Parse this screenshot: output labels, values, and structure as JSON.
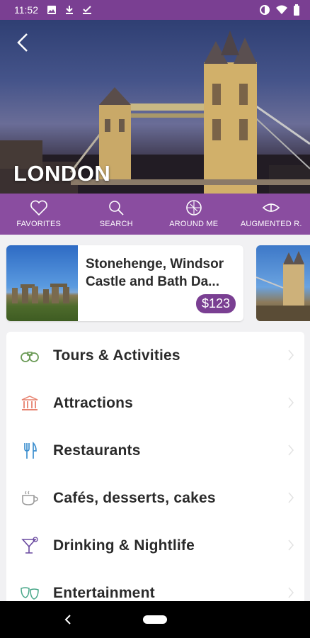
{
  "status_bar": {
    "time": "11:52"
  },
  "hero": {
    "city": "LONDON"
  },
  "tabs": [
    {
      "label": "FAVORITES",
      "icon": "heart-icon"
    },
    {
      "label": "SEARCH",
      "icon": "search-icon"
    },
    {
      "label": "AROUND ME",
      "icon": "compass-icon"
    },
    {
      "label": "AUGMENTED R.",
      "icon": "eye-icon"
    }
  ],
  "featured": {
    "title": "Stonehenge, Windsor Castle and Bath Da...",
    "price": "$123"
  },
  "menu": [
    {
      "label": "Tours & Activities",
      "icon": "binoculars-icon",
      "color": "#6a9a55"
    },
    {
      "label": "Attractions",
      "icon": "museum-icon",
      "color": "#e7826f"
    },
    {
      "label": "Restaurants",
      "icon": "cutlery-icon",
      "color": "#3d8fcf"
    },
    {
      "label": "Cafés, desserts, cakes",
      "icon": "coffee-cup-icon",
      "color": "#9a9a9a"
    },
    {
      "label": "Drinking & Nightlife",
      "icon": "cocktail-icon",
      "color": "#6a4aa0"
    },
    {
      "label": "Entertainment",
      "icon": "masks-icon",
      "color": "#4aa88a"
    }
  ],
  "colors": {
    "primary": "#7a3f92",
    "tabbar": "#8a4da0"
  }
}
